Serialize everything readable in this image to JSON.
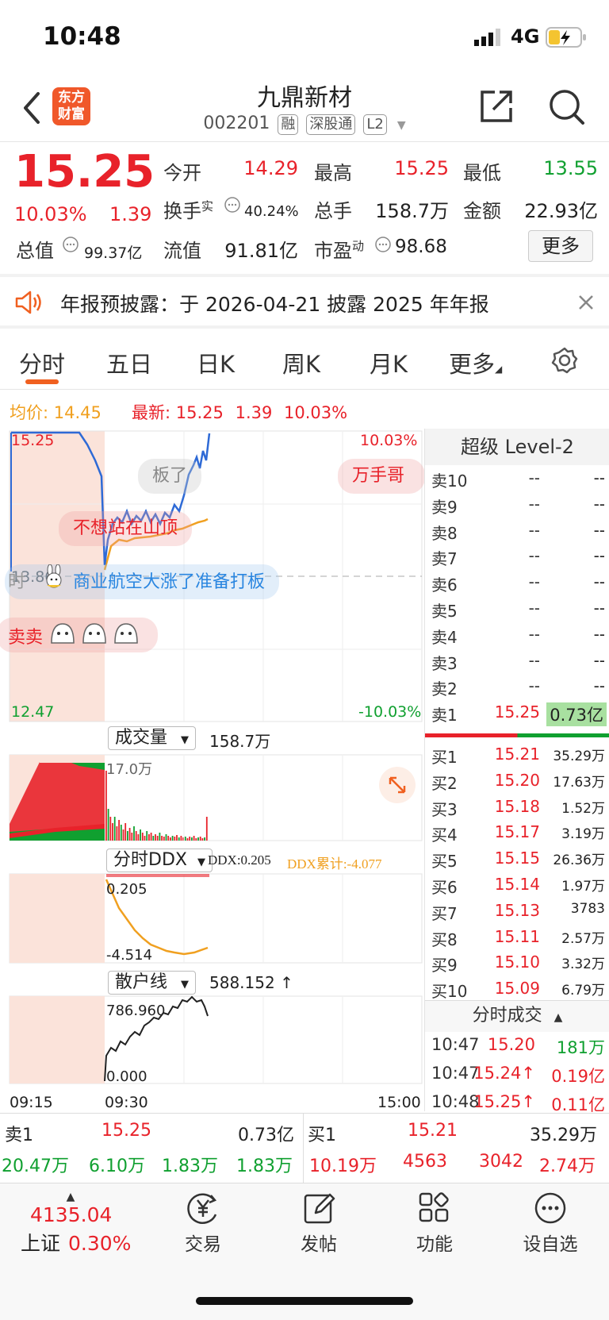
{
  "status_bar": {
    "time": "10:48",
    "network": "4G"
  },
  "header": {
    "title": "九鼎新材",
    "code": "002201",
    "badges": [
      "融",
      "深股通",
      "L2"
    ],
    "logo_line1": "东方",
    "logo_line2": "财富"
  },
  "quote": {
    "price": "15.25",
    "pct": "10.03%",
    "change": "1.39",
    "open_label": "今开",
    "open": "14.29",
    "high_label": "最高",
    "high": "15.25",
    "low_label": "最低",
    "low": "13.55",
    "turnover_label": "换手",
    "turnover_sup": "实",
    "turnover": "40.24%",
    "vol_label": "总手",
    "vol": "158.7万",
    "amount_label": "金额",
    "amount": "22.93亿",
    "mktcap_label": "总值",
    "mktcap": "99.37亿",
    "float_label": "流值",
    "float": "91.81亿",
    "pe_label": "市盈",
    "pe_sup": "动",
    "pe": "98.68",
    "more": "更多"
  },
  "notice": {
    "text": "年报预披露：于 2026-04-21 披露 2025 年年报"
  },
  "tabs": [
    "分时",
    "五日",
    "日K",
    "周K",
    "月K",
    "更多"
  ],
  "infoline": {
    "avg_label": "均价:",
    "avg": "14.45",
    "last_label": "最新:",
    "last": "15.25",
    "chg": "1.39",
    "pct": "10.03%"
  },
  "chart_labels": {
    "top_price": "15.25",
    "top_pct": "10.03%",
    "bot_price": "12.47",
    "bot_pct": "-10.03%",
    "mid_price": "13.86",
    "mid_prefix": "时"
  },
  "danmaku": {
    "a": "板了",
    "b": "万手哥来",
    "c": "不想站在山顶",
    "d": "商业航空大涨了准备打板",
    "e": "卖卖"
  },
  "volume": {
    "label": "成交量",
    "value": "158.7万",
    "axis": "17.0万"
  },
  "ddx": {
    "label": "分时DDX",
    "ddx": "DDX:0.205",
    "ddx_cum": "DDX累计:-4.077",
    "axis_top": "0.205",
    "axis_bot": "-4.514"
  },
  "retail": {
    "label": "散户线",
    "value": "588.152 ↑",
    "axis_top": "786.960",
    "axis_bot": "0.000"
  },
  "time_axis": [
    "09:15",
    "09:30",
    "15:00"
  ],
  "level2": {
    "title": "超级 Level-2",
    "sells": [
      {
        "l": "卖10",
        "p": "--",
        "v": "--"
      },
      {
        "l": "卖9",
        "p": "--",
        "v": "--"
      },
      {
        "l": "卖8",
        "p": "--",
        "v": "--"
      },
      {
        "l": "卖7",
        "p": "--",
        "v": "--"
      },
      {
        "l": "卖6",
        "p": "--",
        "v": "--"
      },
      {
        "l": "卖5",
        "p": "--",
        "v": "--"
      },
      {
        "l": "卖4",
        "p": "--",
        "v": "--"
      },
      {
        "l": "卖3",
        "p": "--",
        "v": "--"
      },
      {
        "l": "卖2",
        "p": "--",
        "v": "--"
      },
      {
        "l": "卖1",
        "p": "15.25",
        "v": "0.73亿"
      }
    ],
    "buys": [
      {
        "l": "买1",
        "p": "15.21",
        "v": "35.29万"
      },
      {
        "l": "买2",
        "p": "15.20",
        "v": "17.63万"
      },
      {
        "l": "买3",
        "p": "15.18",
        "v": "1.52万"
      },
      {
        "l": "买4",
        "p": "15.17",
        "v": "3.19万"
      },
      {
        "l": "买5",
        "p": "15.15",
        "v": "26.36万"
      },
      {
        "l": "买6",
        "p": "15.14",
        "v": "1.97万"
      },
      {
        "l": "买7",
        "p": "15.13",
        "v": "3783"
      },
      {
        "l": "买8",
        "p": "15.11",
        "v": "2.57万"
      },
      {
        "l": "买9",
        "p": "15.10",
        "v": "3.32万"
      },
      {
        "l": "买10",
        "p": "15.09",
        "v": "6.79万"
      }
    ],
    "ticks_title": "分时成交",
    "ticks": [
      {
        "t": "10:47",
        "p": "15.20",
        "v": "181万"
      },
      {
        "t": "10:47",
        "p": "15.24↑",
        "v": "0.19亿"
      },
      {
        "t": "10:48",
        "p": "15.25↑",
        "v": "0.11亿"
      }
    ]
  },
  "bottom_queue": {
    "sell1_label": "卖1",
    "sell1_price": "15.25",
    "sell1_vol": "0.73亿",
    "buy1_label": "买1",
    "buy1_price": "15.21",
    "buy1_vol": "35.29万",
    "sell_q": [
      "20.47万",
      "6.10万",
      "1.83万",
      "1.83万"
    ],
    "buy_q": [
      "10.19万",
      "4563",
      "3042",
      "2.74万"
    ]
  },
  "nav": {
    "index_value": "4135.04",
    "index_name": "上证",
    "index_pct": "0.30%",
    "trade": "交易",
    "post": "发帖",
    "func": "功能",
    "watch": "设自选"
  },
  "colors": {
    "up": "#e8222a",
    "down": "#10a030",
    "avg_line": "#f0a020",
    "price_line": "#2e6ad6"
  }
}
